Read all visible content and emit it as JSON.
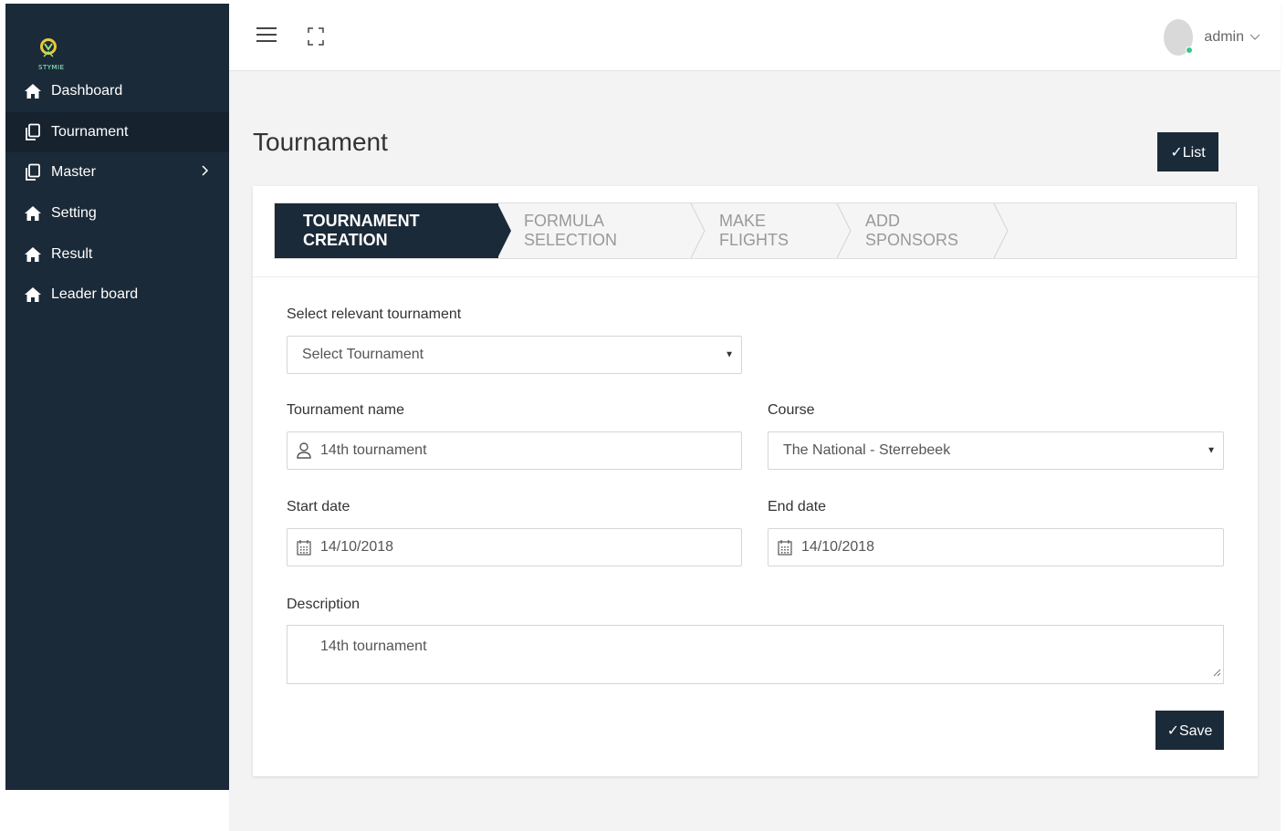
{
  "brand": {
    "logo_text": "STYMIE"
  },
  "sidebar": {
    "items": [
      {
        "label": "Dashboard",
        "icon": "home-icon"
      },
      {
        "label": "Tournament",
        "icon": "copy-icon",
        "active": true
      },
      {
        "label": "Master",
        "icon": "copy-icon",
        "has_submenu": true
      },
      {
        "label": "Setting",
        "icon": "home-icon"
      },
      {
        "label": "Result",
        "icon": "home-icon"
      },
      {
        "label": "Leader board",
        "icon": "home-icon"
      }
    ]
  },
  "topbar": {
    "user_name": "admin",
    "status_color": "#3cc48a"
  },
  "page": {
    "title": "Tournament",
    "list_button": "✓List"
  },
  "wizard": {
    "steps": [
      {
        "label": "TOURNAMENT CREATION",
        "active": true
      },
      {
        "label": "FORMULA SELECTION"
      },
      {
        "label": "MAKE FLIGHTS"
      },
      {
        "label": "ADD SPONSORS"
      }
    ]
  },
  "form": {
    "select_tournament_label": "Select relevant tournament",
    "select_tournament_value": "Select Tournament",
    "tournament_name_label": "Tournament name",
    "tournament_name_value": "14th tournament",
    "course_label": "Course",
    "course_value": "The National - Sterrebeek",
    "start_date_label": "Start date",
    "start_date_value": "14/10/2018",
    "end_date_label": "End date",
    "end_date_value": "14/10/2018",
    "description_label": "Description",
    "description_value": "14th tournament",
    "save_button": "✓Save"
  },
  "colors": {
    "sidebar_bg": "#1b2a38",
    "accent": "#1b2a38",
    "page_bg": "#f3f3f3"
  }
}
